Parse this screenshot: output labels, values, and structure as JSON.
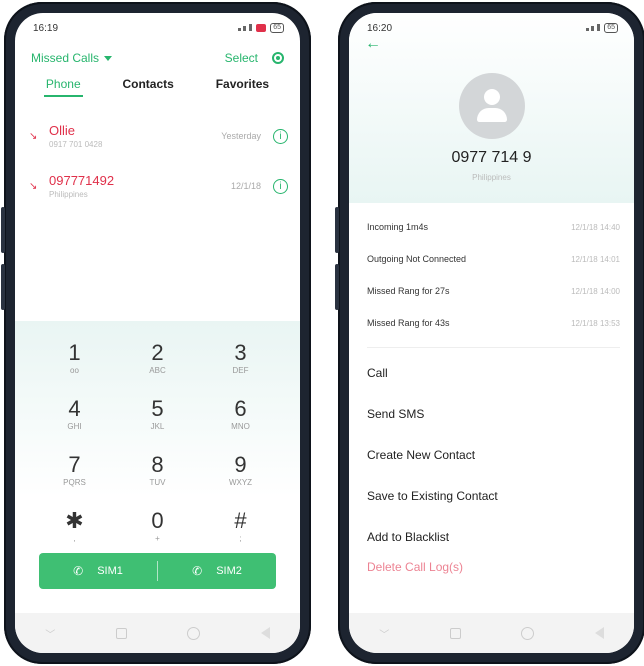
{
  "left": {
    "status": {
      "time": "16:19",
      "battery": "65"
    },
    "filter_label": "Missed Calls",
    "select_label": "Select",
    "tabs": [
      {
        "label": "Phone",
        "active": true
      },
      {
        "label": "Contacts",
        "active": false
      },
      {
        "label": "Favorites",
        "active": false
      }
    ],
    "calls": [
      {
        "name": "Ollie",
        "sub": "0917 701 0428",
        "date": "Yesterday"
      },
      {
        "name": "097771492",
        "sub": "Philippines",
        "date": "12/1/18"
      }
    ],
    "keys": [
      {
        "digit": "1",
        "letters": "ᴏᴏ"
      },
      {
        "digit": "2",
        "letters": "ABC"
      },
      {
        "digit": "3",
        "letters": "DEF"
      },
      {
        "digit": "4",
        "letters": "GHI"
      },
      {
        "digit": "5",
        "letters": "JKL"
      },
      {
        "digit": "6",
        "letters": "MNO"
      },
      {
        "digit": "7",
        "letters": "PQRS"
      },
      {
        "digit": "8",
        "letters": "TUV"
      },
      {
        "digit": "9",
        "letters": "WXYZ"
      },
      {
        "digit": "✱",
        "letters": ","
      },
      {
        "digit": "0",
        "letters": "+"
      },
      {
        "digit": "#",
        "letters": ";"
      }
    ],
    "sim1": "SIM1",
    "sim2": "SIM2"
  },
  "right": {
    "status": {
      "time": "16:20",
      "battery": "65"
    },
    "number": "0977 714 9",
    "location": "Philippines",
    "records": [
      {
        "type": "Incoming  1m4s",
        "time": "12/1/18 14:40"
      },
      {
        "type": "Outgoing Not Connected",
        "time": "12/1/18 14:01"
      },
      {
        "type": "Missed  Rang for 27s",
        "time": "12/1/18 14:00"
      },
      {
        "type": "Missed  Rang for 43s",
        "time": "12/1/18 13:53"
      }
    ],
    "actions": [
      "Call",
      "Send SMS",
      "Create New Contact",
      "Save to Existing Contact",
      "Add to Blacklist",
      "Delete Call Log(s)"
    ]
  },
  "colors": {
    "accent": "#27b56d",
    "missed": "#e0304a",
    "frame": "#1d2430"
  },
  "icons": {
    "missed_call": "missed-call-icon",
    "info": "info-icon",
    "settings": "settings-icon",
    "back": "back-arrow-icon",
    "phone": "phone-icon"
  }
}
